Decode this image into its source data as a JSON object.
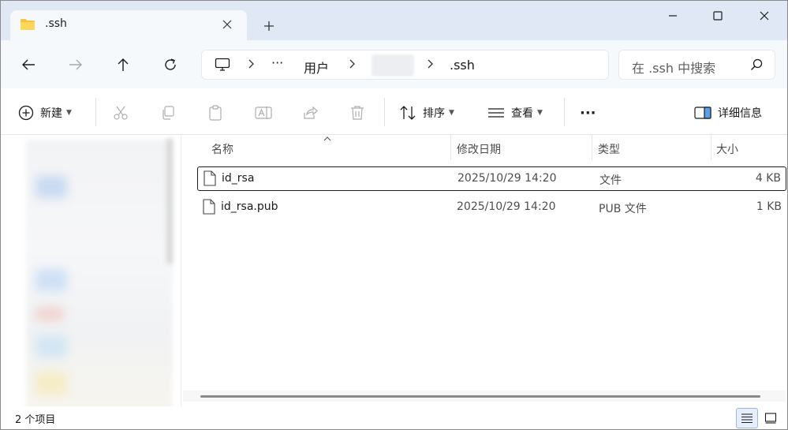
{
  "window": {
    "tab_title": ".ssh",
    "new_tab": "+",
    "tab_close": "✕"
  },
  "navigation": {
    "breadcrumb": {
      "more": "···",
      "items": [
        "用户",
        ".ssh"
      ]
    },
    "search": {
      "placeholder": "在 .ssh 中搜索"
    }
  },
  "toolbar": {
    "new_label": "新建",
    "sort_label": "排序",
    "view_label": "查看",
    "more_label": "···",
    "details_label": "详细信息"
  },
  "file_list": {
    "columns": {
      "name": "名称",
      "date": "修改日期",
      "type": "类型",
      "size": "大小"
    },
    "rows": [
      {
        "name": "id_rsa",
        "date": "2025/10/29 14:20",
        "type": "文件",
        "size": "4 KB",
        "selected": true
      },
      {
        "name": "id_rsa.pub",
        "date": "2025/10/29 14:20",
        "type": "PUB 文件",
        "size": "1 KB",
        "selected": false
      }
    ]
  },
  "status": {
    "item_count": "2 个项目"
  },
  "colors": {
    "titlebar_bg": "#dfe8f4",
    "folder_yellow": "#f5c242",
    "accent_blue": "#0067c0"
  },
  "icons": {
    "tab": "folder-icon",
    "file": "file-icon",
    "search": "search-icon"
  }
}
